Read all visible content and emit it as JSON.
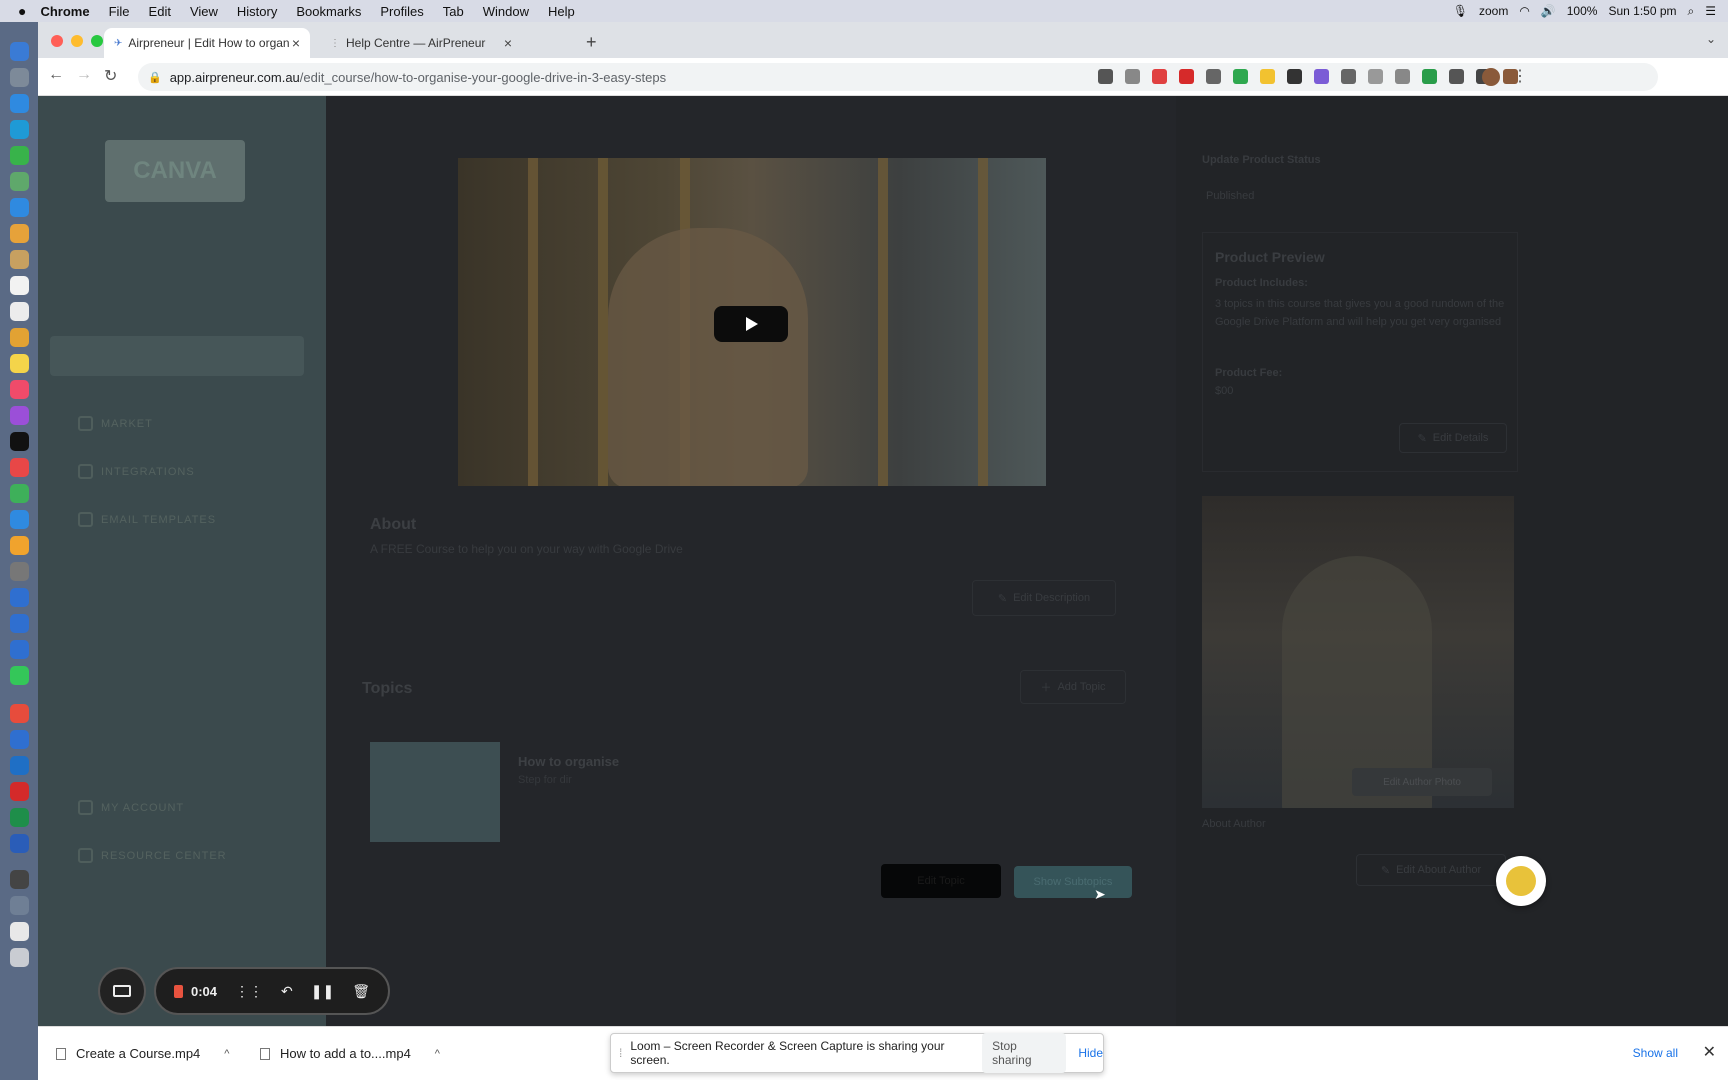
{
  "menubar": {
    "apple": "",
    "items": [
      "Chrome",
      "File",
      "Edit",
      "View",
      "History",
      "Bookmarks",
      "Profiles",
      "Tab",
      "Window",
      "Help"
    ],
    "battery": "100%",
    "clock": "Sun 1:50 pm",
    "zoom_label": "zoom"
  },
  "browser": {
    "tabs": [
      {
        "title": "Airpreneur | Edit How to organ",
        "close": "×"
      },
      {
        "title": "Help Centre — AirPreneur",
        "close": "×"
      }
    ],
    "new_tab": "+",
    "tab_menu": "⌄",
    "nav": {
      "back": "←",
      "forward": "→",
      "reload": "↻"
    },
    "url": {
      "lock": "🔒",
      "host": "app.airpreneur.com.au",
      "path": "/edit_course/how-to-organise-your-google-drive-in-3-easy-steps"
    },
    "ext_colors": [
      "#555555",
      "#888888",
      "#e04040",
      "#d62a2a",
      "#666666",
      "#2fa84f",
      "#f2c230",
      "#333333",
      "#7b5cd6",
      "#666666",
      "#999999",
      "#888888",
      "#2a9d4a",
      "#555555",
      "#444444",
      "#8a5a3a"
    ]
  },
  "app": {
    "logo": "CANVA",
    "nav": [
      "MARKET",
      "INTEGRATIONS",
      "EMAIL TEMPLATES"
    ],
    "bottom_nav": [
      "MY ACCOUNT",
      "RESOURCE CENTER"
    ],
    "about_title": "About",
    "about_text": "A FREE Course to help you on your way with Google Drive",
    "edit_description": "Edit Description",
    "topics_title": "Topics",
    "add_topic": "Add Topic",
    "topic": {
      "name": "How to organise",
      "sub": "Step for dir"
    },
    "btn_edit_topic": "Edit Topic",
    "btn_show_subtopics": "Show Subtopics",
    "right": {
      "status_label": "Update Product Status",
      "status_value": "Published",
      "preview_title": "Product Preview",
      "includes_label": "Product Includes:",
      "includes_text": "3 topics in this course that gives you a good rundown of the Google Drive Platform and will help you get very organised",
      "fee_label": "Product Fee:",
      "fee_value": "$00",
      "edit_details": "Edit Details",
      "edit_author_photo": "Edit Author Photo",
      "about_author": "About Author",
      "edit_about_author": "Edit About Author"
    }
  },
  "recorder": {
    "time": "0:04"
  },
  "downloads": {
    "items": [
      {
        "name": "Create a Course.mp4"
      },
      {
        "name": "How to add a to....mp4"
      }
    ],
    "share_text": "Loom – Screen Recorder & Screen Capture is sharing your screen.",
    "stop_sharing": "Stop sharing",
    "hide": "Hide",
    "show_all": "Show all",
    "close": "✕"
  }
}
